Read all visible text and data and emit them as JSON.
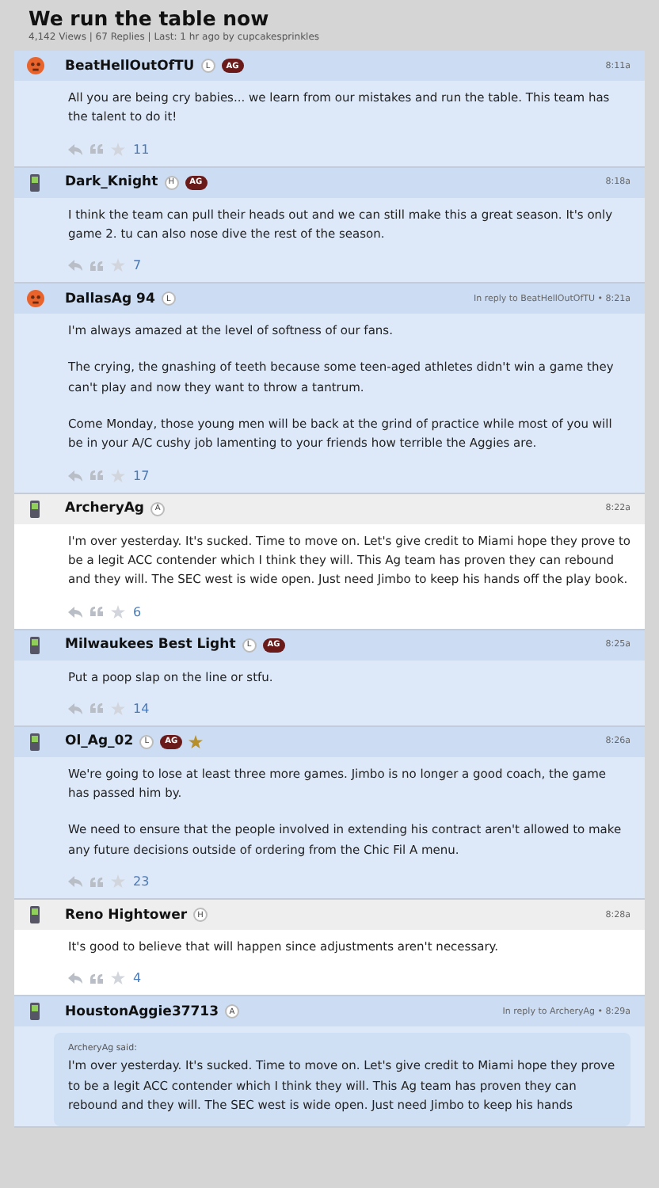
{
  "thread": {
    "title": "We run the table now",
    "meta": "4,142 Views | 67 Replies | Last: 1 hr ago by cupcakesprinkles"
  },
  "posts": [
    {
      "author": "BeatHellOutOfTU",
      "avatar": {
        "kind": "face"
      },
      "badges": [
        {
          "kind": "letter",
          "text": "L"
        },
        {
          "kind": "team",
          "text": "AG"
        }
      ],
      "starred": false,
      "highlighted": true,
      "time": "8:11a",
      "paragraphs": [
        "All you are being cry babies... we learn from our mistakes and run the table. This team has the talent to do it!"
      ],
      "likes": "11"
    },
    {
      "author": "Dark_Knight",
      "avatar": {
        "kind": "phone"
      },
      "badges": [
        {
          "kind": "letter",
          "text": "H"
        },
        {
          "kind": "team",
          "text": "AG"
        }
      ],
      "starred": false,
      "highlighted": true,
      "time": "8:18a",
      "paragraphs": [
        "I think the team can pull their heads out and we can still make this a great season. It's only game 2. tu can also nose dive the rest of the season."
      ],
      "likes": "7"
    },
    {
      "author": "DallasAg 94",
      "avatar": {
        "kind": "face"
      },
      "badges": [
        {
          "kind": "letter",
          "text": "L"
        }
      ],
      "starred": false,
      "highlighted": true,
      "time": "In reply to BeatHellOutOfTU • 8:21a",
      "paragraphs": [
        "I'm always amazed at the level of softness of our fans.",
        "The crying, the gnashing of teeth because some teen-aged athletes didn't win a game they can't play and now they want to throw a tantrum.",
        "Come Monday, those young men will be back at the grind of practice while most of you will be in your A/C cushy job lamenting to your friends how terrible the Aggies are."
      ],
      "likes": "17"
    },
    {
      "author": "ArcheryAg",
      "avatar": {
        "kind": "phone"
      },
      "badges": [
        {
          "kind": "letter",
          "text": "A"
        }
      ],
      "starred": false,
      "highlighted": false,
      "time": "8:22a",
      "paragraphs": [
        "I'm over yesterday. It's sucked. Time to move on. Let's give credit to Miami hope they prove to be a legit ACC contender which I think they will. This Ag team has proven they can rebound and they will. The SEC west is wide open. Just need Jimbo to keep his hands off the play book."
      ],
      "likes": "6"
    },
    {
      "author": "Milwaukees Best Light",
      "avatar": {
        "kind": "phone"
      },
      "badges": [
        {
          "kind": "letter",
          "text": "L"
        },
        {
          "kind": "team",
          "text": "AG"
        }
      ],
      "starred": false,
      "highlighted": true,
      "time": "8:25a",
      "paragraphs": [
        "Put a poop slap on the line or stfu."
      ],
      "likes": "14"
    },
    {
      "author": "Ol_Ag_02",
      "avatar": {
        "kind": "phone"
      },
      "badges": [
        {
          "kind": "letter",
          "text": "L"
        },
        {
          "kind": "team",
          "text": "AG"
        }
      ],
      "starred": true,
      "highlighted": true,
      "time": "8:26a",
      "paragraphs": [
        "We're going to lose at least three more games. Jimbo is no longer a good coach, the game has passed him by.",
        "We need to ensure that the people involved in extending his contract aren't allowed to make any future decisions outside of ordering from the Chic Fil A menu."
      ],
      "likes": "23"
    },
    {
      "author": "Reno Hightower",
      "avatar": {
        "kind": "phone"
      },
      "badges": [
        {
          "kind": "letter",
          "text": "H"
        }
      ],
      "starred": false,
      "highlighted": false,
      "time": "8:28a",
      "paragraphs": [
        "It's good to believe that will happen since adjustments aren't necessary."
      ],
      "likes": "4"
    },
    {
      "author": "HoustonAggie37713",
      "avatar": {
        "kind": "phone"
      },
      "badges": [
        {
          "kind": "letter",
          "text": "A"
        }
      ],
      "starred": false,
      "highlighted": true,
      "time": "In reply to ArcheryAg • 8:29a",
      "quote": {
        "by": "ArcheryAg said:",
        "text": "I'm over yesterday. It's sucked. Time to move on. Let's give credit to Miami hope they prove to be a legit ACC contender which I think they will. This Ag team has proven they can rebound and they will. The SEC west is wide open. Just need Jimbo to keep his hands"
      }
    }
  ]
}
